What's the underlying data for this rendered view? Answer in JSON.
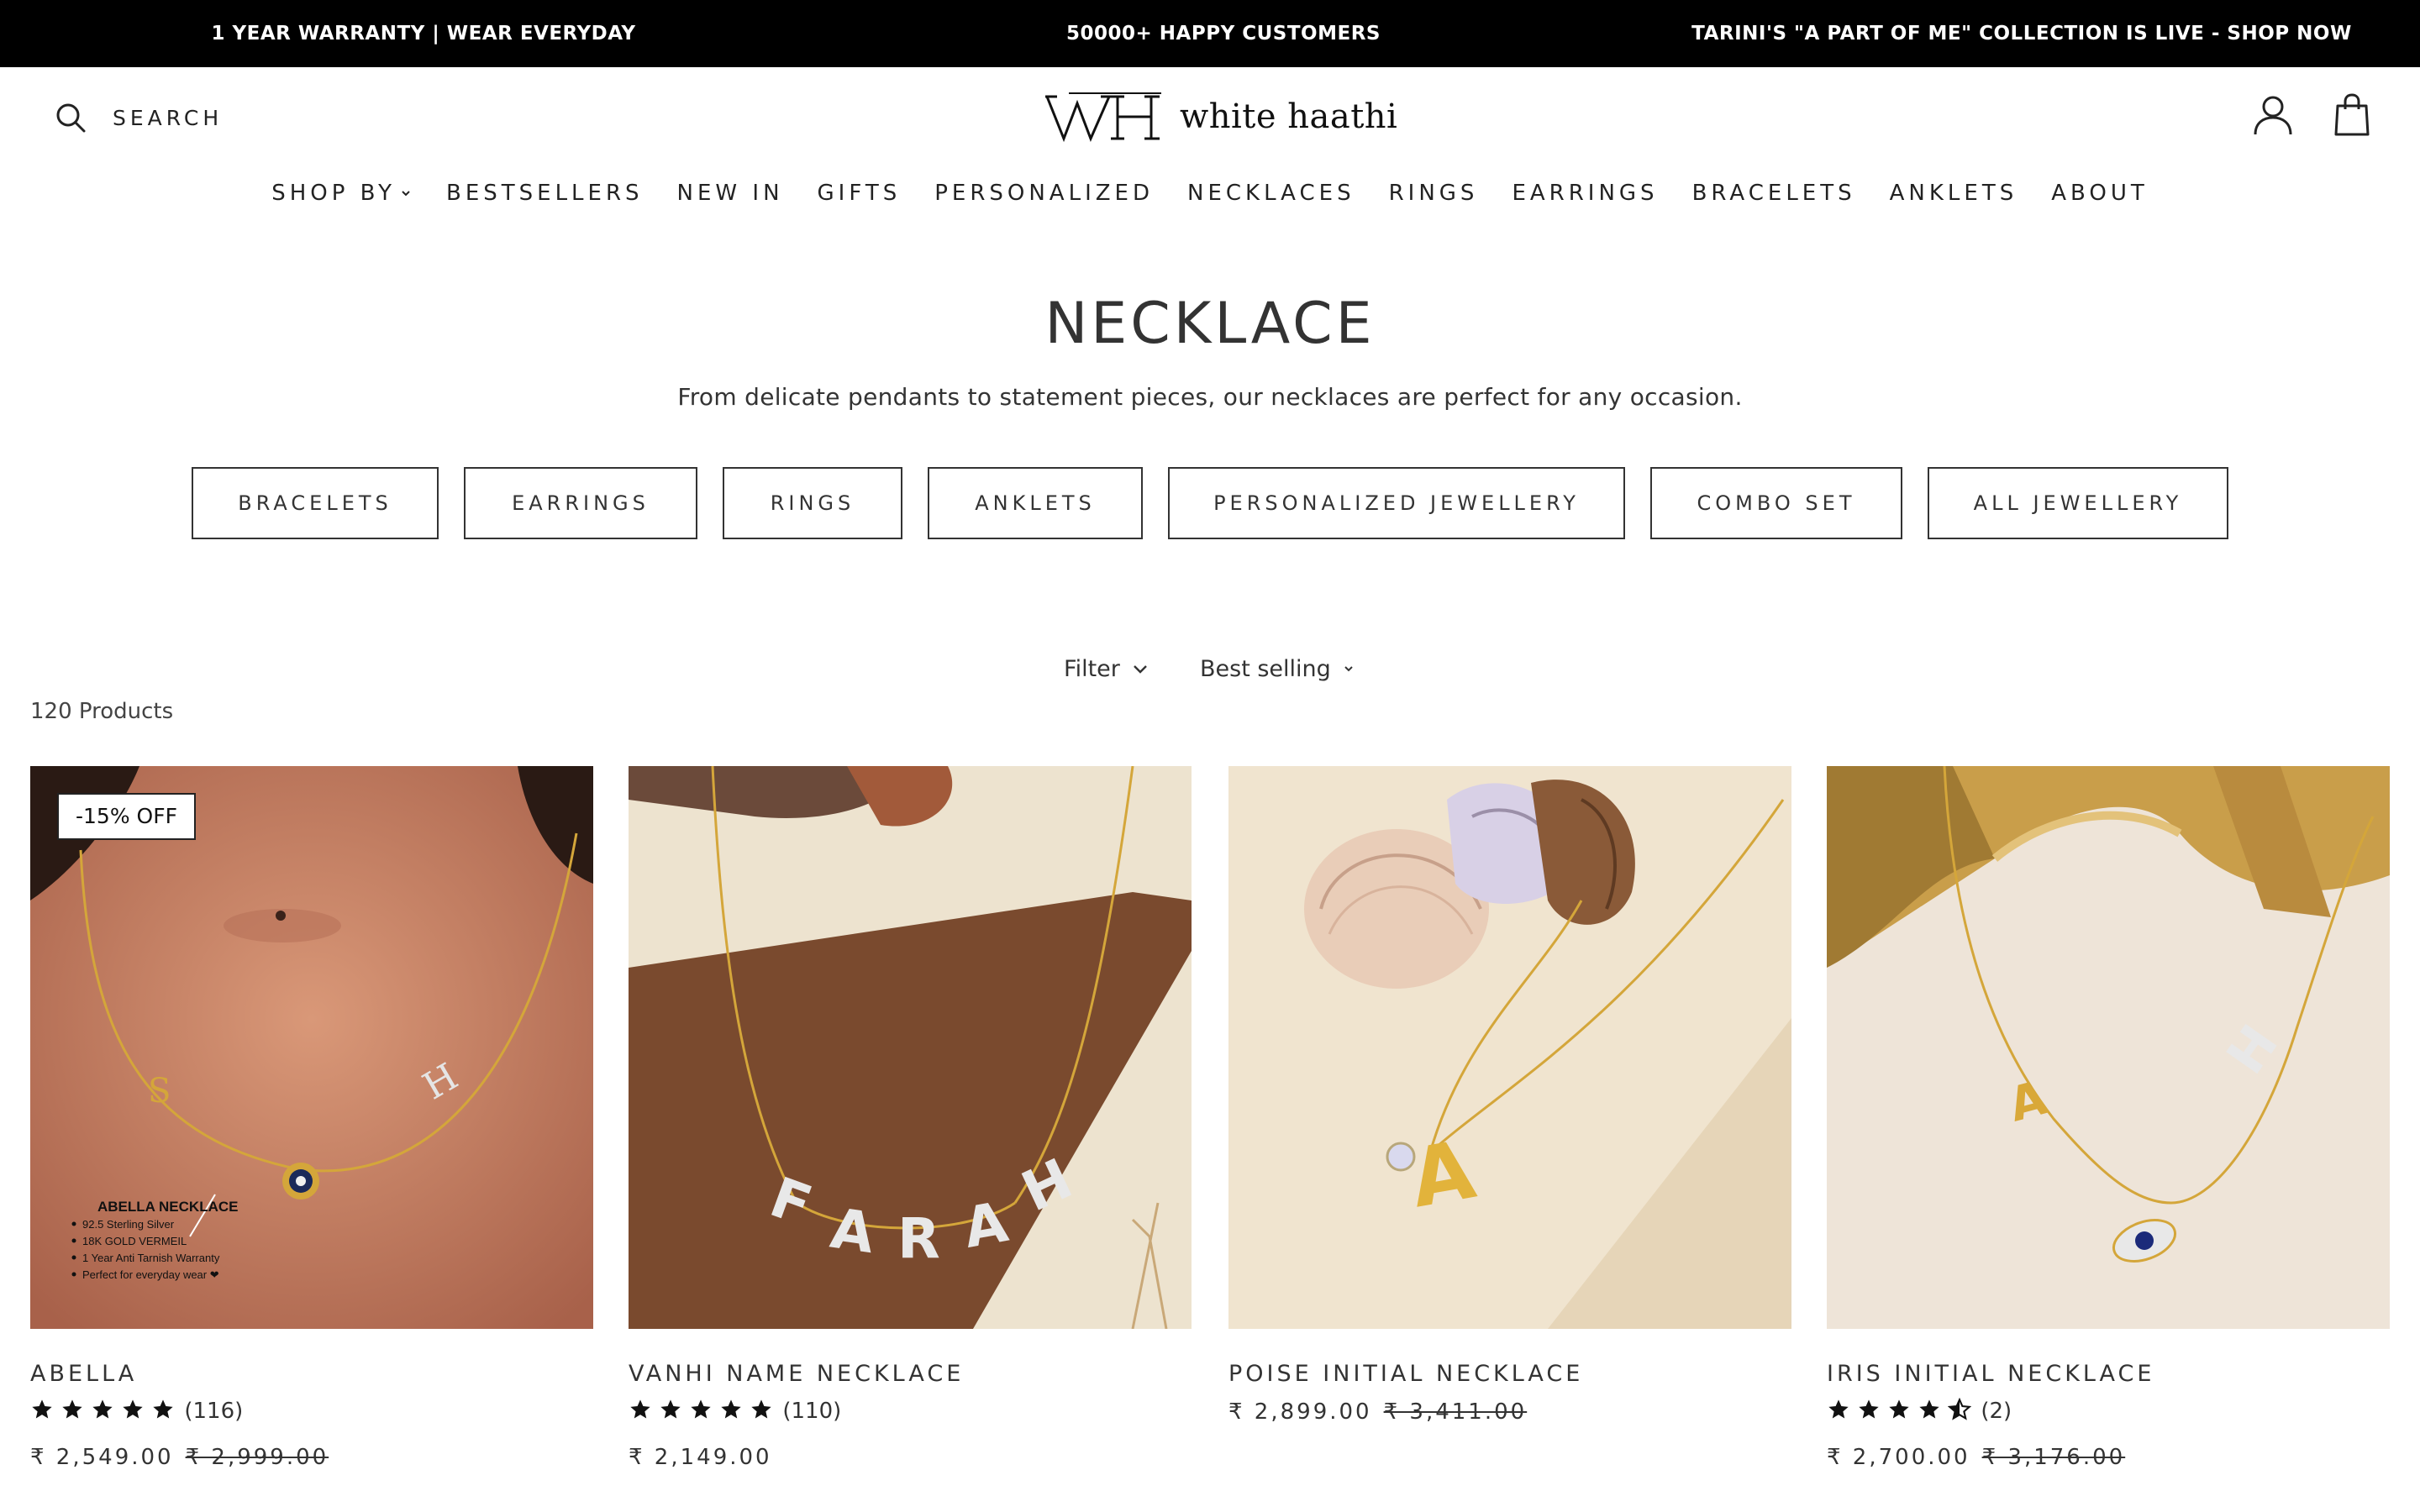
{
  "announcements": [
    "1 YEAR WARRANTY | WEAR EVERYDAY",
    "50000+ HAPPY CUSTOMERS",
    "TARINI'S \"A PART OF ME\" COLLECTION IS LIVE - SHOP NOW"
  ],
  "header": {
    "search_label": "SEARCH",
    "brand_name": "white haathi",
    "icons": [
      "search-icon",
      "account-icon",
      "cart-bag-icon"
    ]
  },
  "nav": [
    "SHOP BY",
    "BESTSELLERS",
    "NEW IN",
    "GIFTS",
    "PERSONALIZED",
    "NECKLACES",
    "RINGS",
    "EARRINGS",
    "BRACELETS",
    "ANKLETS",
    "ABOUT"
  ],
  "collection": {
    "title": "NECKLACE",
    "description": "From delicate pendants to statement pieces, our necklaces are perfect for any occasion."
  },
  "chips": [
    "BRACELETS",
    "EARRINGS",
    "RINGS",
    "ANKLETS",
    "PERSONALIZED JEWELLERY",
    "COMBO SET",
    "ALL JEWELLERY"
  ],
  "toolbar": {
    "filter_label": "Filter",
    "sort_label": "Best selling",
    "product_count": "120 Products"
  },
  "products": [
    {
      "name": "ABELLA",
      "badge": "-15% OFF",
      "rating": 5,
      "reviews": "(116)",
      "price": "₹ 2,549.00",
      "compare_price": "₹ 2,999.00",
      "image_caption": {
        "title": "ABELLA NECKLACE",
        "bullets": [
          "92.5 Sterling Silver",
          "18K GOLD VERMEIL",
          "1 Year Anti Tarnish Warranty",
          "Perfect for everyday wear ❤"
        ]
      },
      "image_letters": [
        "S",
        "H"
      ]
    },
    {
      "name": "VANHI NAME NECKLACE",
      "rating": 5,
      "reviews": "(110)",
      "price": "₹ 2,149.00",
      "image_letters": [
        "F",
        "A",
        "R",
        "A",
        "H"
      ]
    },
    {
      "name": "POISE INITIAL NECKLACE",
      "price": "₹ 2,899.00",
      "compare_price": "₹ 3,411.00",
      "image_letters": [
        "A"
      ]
    },
    {
      "name": "IRIS INITIAL NECKLACE",
      "rating": 4.5,
      "reviews": "(2)",
      "price": "₹ 2,700.00",
      "compare_price": "₹ 3,176.00",
      "image_letters": [
        "A",
        "H"
      ]
    }
  ],
  "colors": {
    "announcement_bg": "#000000",
    "text": "#222222",
    "gold": "#d4a63a"
  }
}
